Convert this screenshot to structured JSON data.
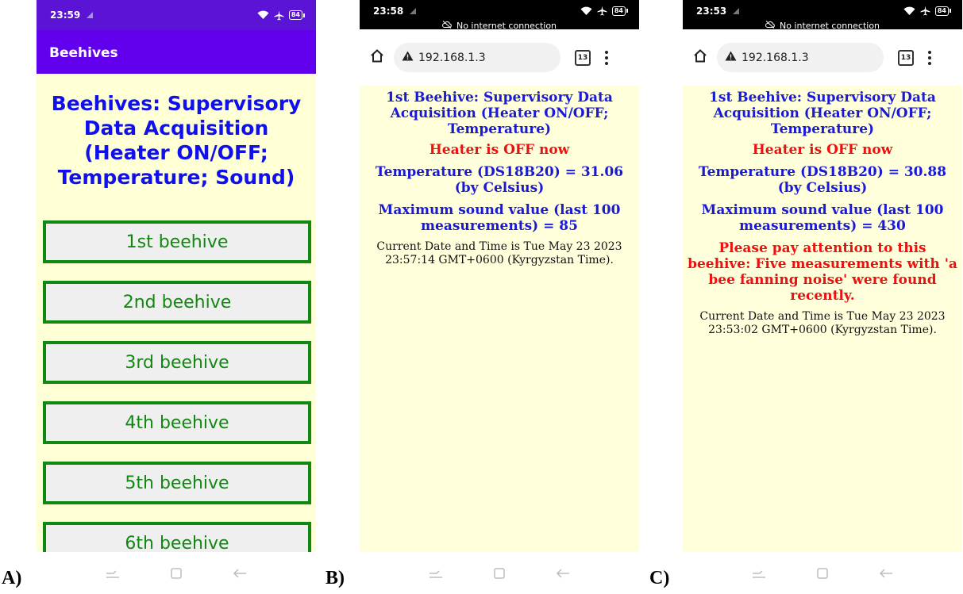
{
  "panels": {
    "a": {
      "letter": "A)",
      "status_time": "23:59",
      "battery": "84",
      "app_title": "Beehives",
      "heading": "Beehives: Supervisory Data Acquisition (Heater ON/OFF; Temperature; Sound)",
      "buttons": [
        "1st beehive",
        "2nd beehive",
        "3rd beehive",
        "4th beehive",
        "5th beehive",
        "6th beehive"
      ]
    },
    "b": {
      "letter": "B)",
      "status_time": "23:58",
      "battery": "84",
      "offline": "No internet connection",
      "url": "192.168.1.3",
      "tabs": "13",
      "title": "1st Beehive: Supervisory Data Acquisition (Heater ON/OFF; Temperature)",
      "heater": "Heater is OFF now",
      "temperature": "Temperature (DS18B20) = 31.06 (by Celsius)",
      "sound": "Maximum sound value (last 100 measurements) = 85",
      "datetime": "Current Date and Time is Tue May 23 2023 23:57:14 GMT+0600 (Kyrgyzstan Time)."
    },
    "c": {
      "letter": "C)",
      "status_time": "23:53",
      "battery": "84",
      "offline": "No internet connection",
      "url": "192.168.1.3",
      "tabs": "13",
      "title": "1st Beehive: Supervisory Data Acquisition (Heater ON/OFF; Temperature)",
      "heater": "Heater is OFF now",
      "temperature": "Temperature (DS18B20) = 30.88 (by Celsius)",
      "sound": "Maximum sound value (last 100 measurements) = 430",
      "warning": "Please pay attention to this beehive: Five measurements with 'a bee fanning noise' were found recently.",
      "datetime": "Current Date and Time is Tue May 23 2023 23:53:02 GMT+0600 (Kyrgyzstan Time)."
    }
  },
  "colors": {
    "app_bar": "#6200ee",
    "app_background": "#ffffd6",
    "heading_blue": "#1010ee",
    "button_green": "#118811",
    "alert_red": "#ee1010",
    "web_background": "#ffffdc"
  },
  "icons": {
    "status": [
      "signal-icon",
      "wifi-icon",
      "airplane-icon",
      "battery-icon"
    ],
    "browser": [
      "home-icon",
      "warning-icon",
      "tab-switcher-icon",
      "menu-icon"
    ],
    "nav": [
      "recents-icon",
      "home-square-icon",
      "back-icon"
    ]
  }
}
